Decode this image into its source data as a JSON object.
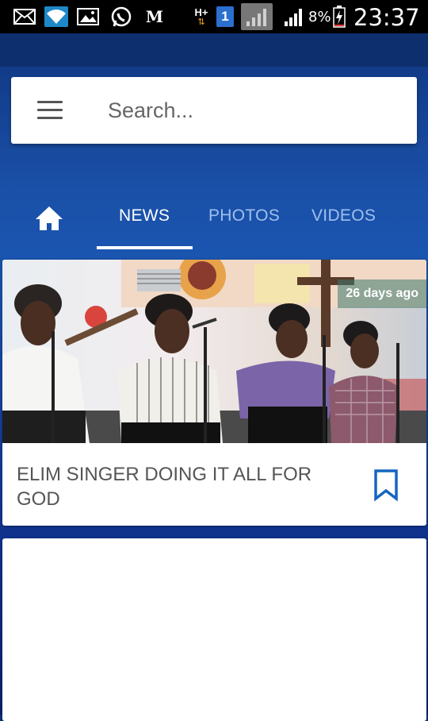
{
  "status_bar": {
    "icons": [
      "mail-icon",
      "wifi-icon",
      "gallery-icon",
      "whatsapp-icon",
      "mtn-icon",
      "h-plus-data-icon",
      "sim-1-icon",
      "signal-weak-icon",
      "signal-icon",
      "battery-charging-icon"
    ],
    "network_label": "H+",
    "sim_label": "1",
    "m_label": "M",
    "battery": "8%",
    "time": "23:37"
  },
  "search": {
    "placeholder": "Search...",
    "value": ""
  },
  "tabs": {
    "home_icon": "home-icon",
    "items": [
      {
        "label": "NEWS",
        "active": true
      },
      {
        "label": "PHOTOS",
        "active": false
      },
      {
        "label": "VIDEOS",
        "active": false
      }
    ]
  },
  "feed": {
    "items": [
      {
        "time_ago": "26 days ago",
        "title": "ELIM SINGER DOING IT ALL FOR GOD",
        "bookmark_icon": "bookmark-icon"
      }
    ]
  },
  "colors": {
    "accent_blue": "#1565c0",
    "tab_inactive": "#9fc0ee"
  }
}
